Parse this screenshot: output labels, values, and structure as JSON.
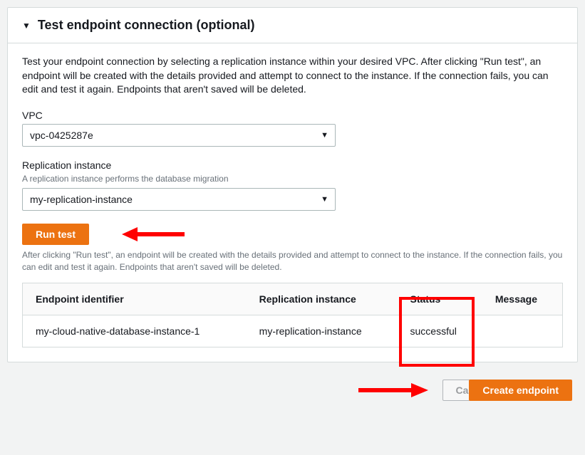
{
  "panel": {
    "title": "Test endpoint connection (optional)",
    "description": "Test your endpoint connection by selecting a replication instance within your desired VPC. After clicking \"Run test\", an endpoint will be created with the details provided and attempt to connect to the instance. If the connection fails, you can edit and test it again. Endpoints that aren't saved will be deleted."
  },
  "vpc": {
    "label": "VPC",
    "value": "vpc-0425287e"
  },
  "replication": {
    "label": "Replication instance",
    "hint": "A replication instance performs the database migration",
    "value": "my-replication-instance"
  },
  "runTest": {
    "label": "Run test",
    "hint": "After clicking \"Run test\", an endpoint will be created with the details provided and attempt to connect to the instance. If the connection fails, you can edit and test it again. Endpoints that aren't saved will be deleted."
  },
  "table": {
    "headers": {
      "endpoint": "Endpoint identifier",
      "replication": "Replication instance",
      "status": "Status",
      "message": "Message"
    },
    "row": {
      "endpoint": "my-cloud-native-database-instance-1",
      "replication": "my-replication-instance",
      "status": "successful",
      "message": ""
    }
  },
  "footer": {
    "cancel": "Cancel",
    "create": "Create endpoint"
  }
}
